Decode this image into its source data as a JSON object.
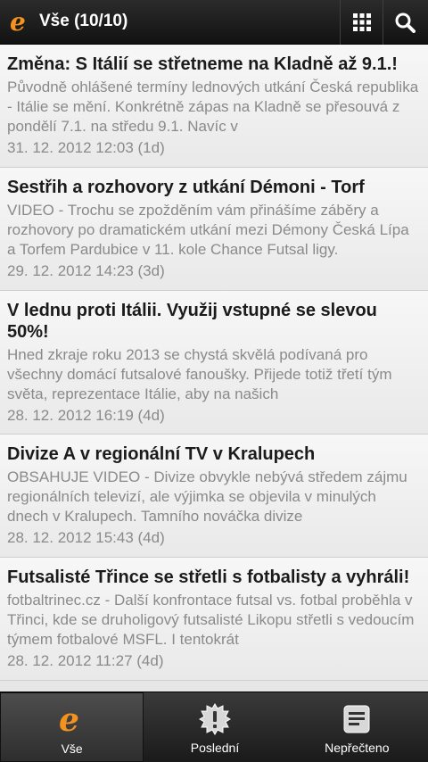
{
  "app": {
    "title": "Vše (10/10)",
    "logo_letter": "e"
  },
  "colors": {
    "accent": "#f5921e",
    "title": "#1b1b1b",
    "muted": "#8a8a8a"
  },
  "articles": [
    {
      "title": "Změna: S Itálií se střetneme na Kladně až 9.1.!",
      "snippet": "Původně ohlášené termíny lednových utkání Česká republika - Itálie se mění. Konkrétně zápas na Kladně se přesouvá z pondělí 7.1. na středu 9.1. Navíc v",
      "date": "31. 12. 2012 12:03 (1d)"
    },
    {
      "title": "Sestřih a rozhovory z utkání Démoni - Torf",
      "snippet": "VIDEO - Trochu se zpožděním vám přinášíme záběry a rozhovory po dramatickém utkání mezi Démony Česká Lípa a Torfem Pardubice v 11. kole Chance Futsal ligy.",
      "date": "29. 12. 2012 14:23 (3d)"
    },
    {
      "title": "V lednu proti Itálii. Využij vstupné se slevou 50%!",
      "snippet": "Hned zkraje roku 2013 se chystá skvělá podívaná pro všechny domácí futsalové fanoušky. Přijede totiž třetí tým světa, reprezentace Itálie, aby na našich",
      "date": "28. 12. 2012 16:19 (4d)"
    },
    {
      "title": "Divize A v regionální TV v Kralupech",
      "snippet": "OBSAHUJE VIDEO - Divize obvykle nebývá středem zájmu regionálních televizí, ale výjimka se objevila v minulých dnech v Kralupech. Tamního nováčka divize",
      "date": "28. 12. 2012 15:43 (4d)"
    },
    {
      "title": "Futsalisté Třince se střetli s fotbalisty a vyhráli!",
      "snippet": "fotbaltrinec.cz - Další konfrontace futsal vs. fotbal proběhla v Třinci, kde se druholigový futsalisté Likopu střetli s vedoucím týmem fotbalové MSFL. I tentokrát",
      "date": "28. 12. 2012 11:27 (4d)"
    }
  ],
  "tabs": [
    {
      "label": "Vše",
      "icon": "e-logo-icon"
    },
    {
      "label": "Poslední",
      "icon": "badge-alert-icon"
    },
    {
      "label": "Nepřečteno",
      "icon": "document-icon"
    }
  ]
}
